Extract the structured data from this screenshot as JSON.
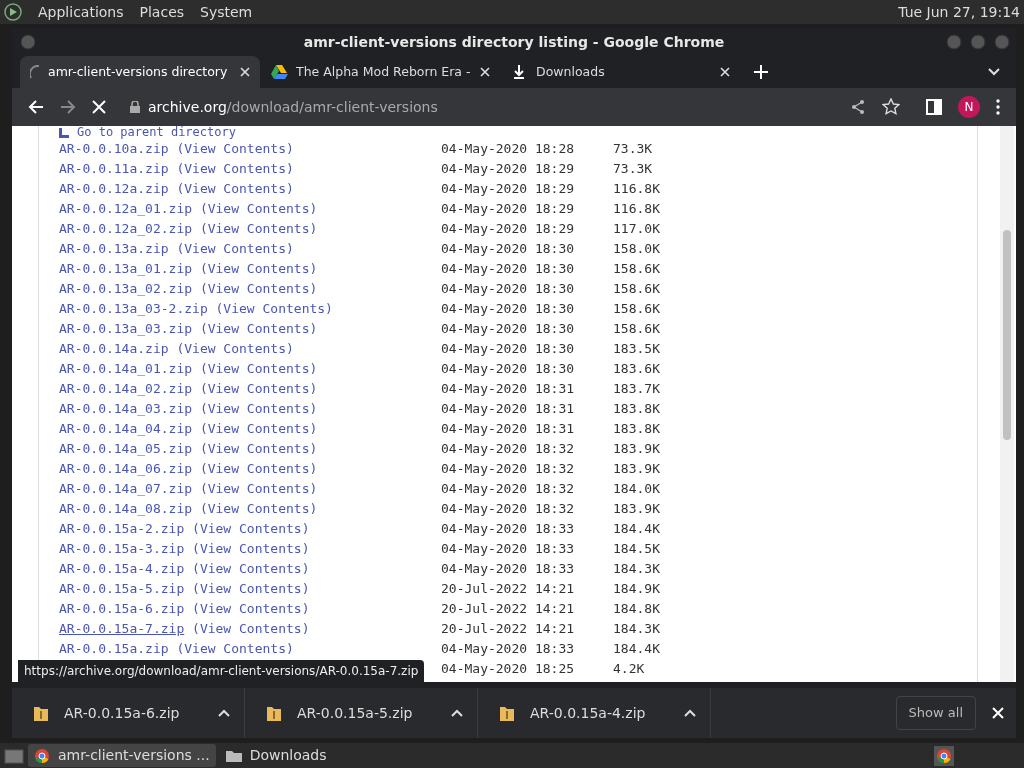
{
  "desktop_panel": {
    "menus": [
      "Applications",
      "Places",
      "System"
    ],
    "clock": "Tue Jun 27, 19:14"
  },
  "window": {
    "title": "amr-client-versions directory listing - Google Chrome"
  },
  "tabs": [
    {
      "label": "amr-client-versions directory",
      "kind": "loading",
      "selected": true
    },
    {
      "label": "The Alpha Mod Reborn Era -",
      "kind": "drive",
      "selected": false
    },
    {
      "label": "Downloads",
      "kind": "download",
      "selected": false
    }
  ],
  "toolbar": {
    "url_host": "archive.org",
    "url_path": "/download/amr-client-versions",
    "avatar": "N"
  },
  "listing": {
    "parent_link": "Go to parent directory",
    "rows": [
      {
        "name": "AR-0.0.10a.zip",
        "view": "(View Contents)",
        "date": "04-May-2020 18:28",
        "size": "73.3K",
        "hovered": false
      },
      {
        "name": "AR-0.0.11a.zip",
        "view": "(View Contents)",
        "date": "04-May-2020 18:29",
        "size": "73.3K",
        "hovered": false
      },
      {
        "name": "AR-0.0.12a.zip",
        "view": "(View Contents)",
        "date": "04-May-2020 18:29",
        "size": "116.8K",
        "hovered": false
      },
      {
        "name": "AR-0.0.12a_01.zip",
        "view": "(View Contents)",
        "date": "04-May-2020 18:29",
        "size": "116.8K",
        "hovered": false
      },
      {
        "name": "AR-0.0.12a_02.zip",
        "view": "(View Contents)",
        "date": "04-May-2020 18:29",
        "size": "117.0K",
        "hovered": false
      },
      {
        "name": "AR-0.0.13a.zip",
        "view": "(View Contents)",
        "date": "04-May-2020 18:30",
        "size": "158.0K",
        "hovered": false
      },
      {
        "name": "AR-0.0.13a_01.zip",
        "view": "(View Contents)",
        "date": "04-May-2020 18:30",
        "size": "158.6K",
        "hovered": false
      },
      {
        "name": "AR-0.0.13a_02.zip",
        "view": "(View Contents)",
        "date": "04-May-2020 18:30",
        "size": "158.6K",
        "hovered": false
      },
      {
        "name": "AR-0.0.13a_03-2.zip",
        "view": "(View Contents)",
        "date": "04-May-2020 18:30",
        "size": "158.6K",
        "hovered": false
      },
      {
        "name": "AR-0.0.13a_03.zip",
        "view": "(View Contents)",
        "date": "04-May-2020 18:30",
        "size": "158.6K",
        "hovered": false
      },
      {
        "name": "AR-0.0.14a.zip",
        "view": "(View Contents)",
        "date": "04-May-2020 18:30",
        "size": "183.5K",
        "hovered": false
      },
      {
        "name": "AR-0.0.14a_01.zip",
        "view": "(View Contents)",
        "date": "04-May-2020 18:30",
        "size": "183.6K",
        "hovered": false
      },
      {
        "name": "AR-0.0.14a_02.zip",
        "view": "(View Contents)",
        "date": "04-May-2020 18:31",
        "size": "183.7K",
        "hovered": false
      },
      {
        "name": "AR-0.0.14a_03.zip",
        "view": "(View Contents)",
        "date": "04-May-2020 18:31",
        "size": "183.8K",
        "hovered": false
      },
      {
        "name": "AR-0.0.14a_04.zip",
        "view": "(View Contents)",
        "date": "04-May-2020 18:31",
        "size": "183.8K",
        "hovered": false
      },
      {
        "name": "AR-0.0.14a_05.zip",
        "view": "(View Contents)",
        "date": "04-May-2020 18:32",
        "size": "183.9K",
        "hovered": false
      },
      {
        "name": "AR-0.0.14a_06.zip",
        "view": "(View Contents)",
        "date": "04-May-2020 18:32",
        "size": "183.9K",
        "hovered": false
      },
      {
        "name": "AR-0.0.14a_07.zip",
        "view": "(View Contents)",
        "date": "04-May-2020 18:32",
        "size": "184.0K",
        "hovered": false
      },
      {
        "name": "AR-0.0.14a_08.zip",
        "view": "(View Contents)",
        "date": "04-May-2020 18:32",
        "size": "183.9K",
        "hovered": false
      },
      {
        "name": "AR-0.0.15a-2.zip",
        "view": "(View Contents)",
        "date": "04-May-2020 18:33",
        "size": "184.4K",
        "hovered": false
      },
      {
        "name": "AR-0.0.15a-3.zip",
        "view": "(View Contents)",
        "date": "04-May-2020 18:33",
        "size": "184.5K",
        "hovered": false
      },
      {
        "name": "AR-0.0.15a-4.zip",
        "view": "(View Contents)",
        "date": "04-May-2020 18:33",
        "size": "184.3K",
        "hovered": false
      },
      {
        "name": "AR-0.0.15a-5.zip",
        "view": "(View Contents)",
        "date": "20-Jul-2022 14:21",
        "size": "184.9K",
        "hovered": false
      },
      {
        "name": "AR-0.0.15a-6.zip",
        "view": "(View Contents)",
        "date": "20-Jul-2022 14:21",
        "size": "184.8K",
        "hovered": false
      },
      {
        "name": "AR-0.0.15a-7.zip",
        "view": "(View Contents)",
        "date": "20-Jul-2022 14:21",
        "size": "184.3K",
        "hovered": true
      },
      {
        "name": "AR-0.0.15a.zip",
        "view": "(View Contents)",
        "date": "04-May-2020 18:33",
        "size": "184.4K",
        "hovered": false
      }
    ],
    "partial_row": {
      "date": "04-May-2020 18:25",
      "size": "4.2K"
    }
  },
  "status_url": "https://archive.org/download/amr-client-versions/AR-0.0.15a-7.zip",
  "downloads": [
    {
      "file": "AR-0.0.15a-6.zip"
    },
    {
      "file": "AR-0.0.15a-5.zip"
    },
    {
      "file": "AR-0.0.15a-4.zip"
    }
  ],
  "downloads_button": "Show all",
  "taskbar": [
    {
      "label": "amr-client-versions ...",
      "kind": "browser",
      "selected": true
    },
    {
      "label": "Downloads",
      "kind": "folder",
      "selected": false
    }
  ]
}
